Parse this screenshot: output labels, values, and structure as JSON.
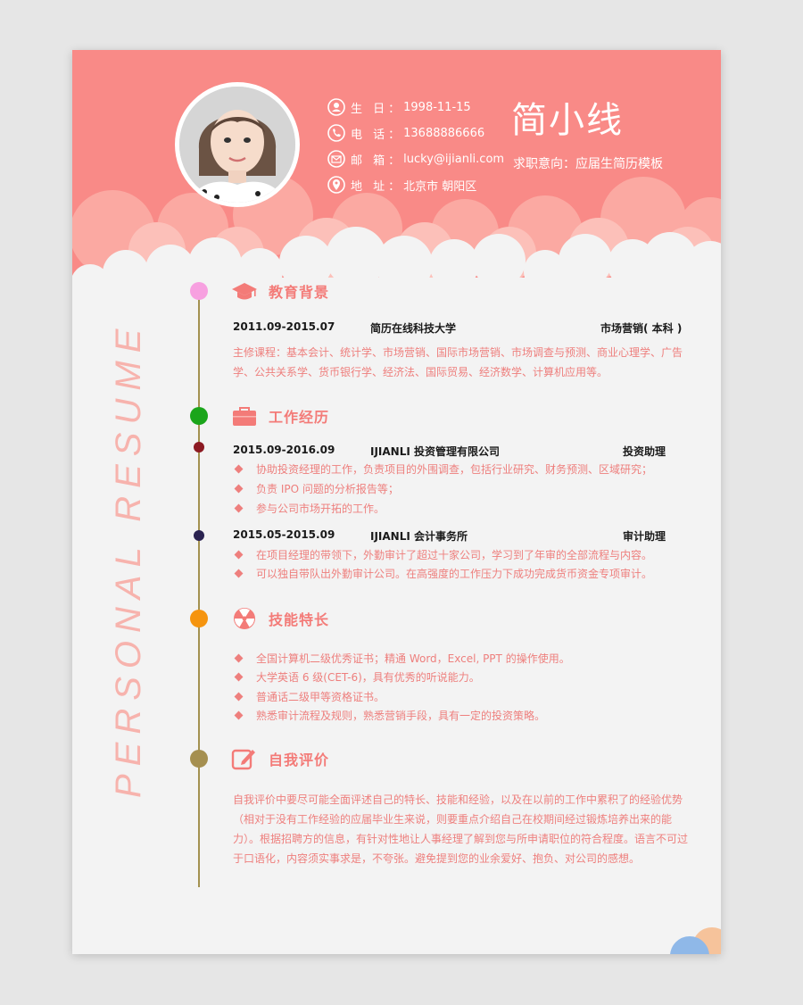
{
  "colors": {
    "header": "#f98a87",
    "accent": "#f37b78",
    "text_pink": "#ee7f7d",
    "timeline": "#a39150"
  },
  "contact": {
    "birthday_label": "生 日：",
    "birthday": "1998-11-15",
    "phone_label": "电 话：",
    "phone": "13688886666",
    "email_label": "邮 箱：",
    "email": "lucky@ijianli.com",
    "address_label": "地 址：",
    "address": "北京市 朝阳区"
  },
  "profile": {
    "name": "简小线",
    "intent": "求职意向：应届生简历模板"
  },
  "watermark": "PERSONAL RESUME",
  "education": {
    "title": "教育背景",
    "period": "2011.09-2015.07",
    "school": "简历在线科技大学",
    "major": "市场营销( 本科 )",
    "courses": "主修课程：基本会计、统计学、市场营销、国际市场营销、市场调查与预测、商业心理学、广告学、公共关系学、货币银行学、经济法、国际贸易、经济数学、计算机应用等。"
  },
  "work": {
    "title": "工作经历",
    "jobs": [
      {
        "period": "2015.09-2016.09",
        "company": "IJIANLI 投资管理有限公司",
        "role": "投资助理",
        "duties": [
          "协助投资经理的工作，负责项目的外围调查，包括行业研究、财务预测、区域研究；",
          "负责 IPO 问题的分析报告等；",
          "参与公司市场开拓的工作。"
        ]
      },
      {
        "period": "2015.05-2015.09",
        "company": "IJIANLI 会计事务所",
        "role": "审计助理",
        "duties": [
          "在项目经理的带领下，外勤审计了超过十家公司，学习到了年审的全部流程与内容。",
          "可以独自带队出外勤审计公司。在高强度的工作压力下成功完成货币资金专项审计。"
        ]
      }
    ]
  },
  "skills": {
    "title": "技能特长",
    "items": [
      "全国计算机二级优秀证书；精通 Word，Excel, PPT 的操作使用。",
      "大学英语 6 级(CET-6)，具有优秀的听说能力。",
      "普通话二级甲等资格证书。",
      "熟悉审计流程及规则，熟悉营销手段，具有一定的投资策略。"
    ]
  },
  "self": {
    "title": "自我评价",
    "text": "自我评价中要尽可能全面评述自己的特长、技能和经验，以及在以前的工作中累积了的经验优势（相对于没有工作经验的应届毕业生来说，则要重点介绍自己在校期间经过锻炼培养出来的能力）。根据招聘方的信息，有针对性地让人事经理了解到您与所申请职位的符合程度。语言不可过于口语化，内容须实事求是，不夸张。避免提到您的业余爱好、抱负、对公司的感想。"
  }
}
